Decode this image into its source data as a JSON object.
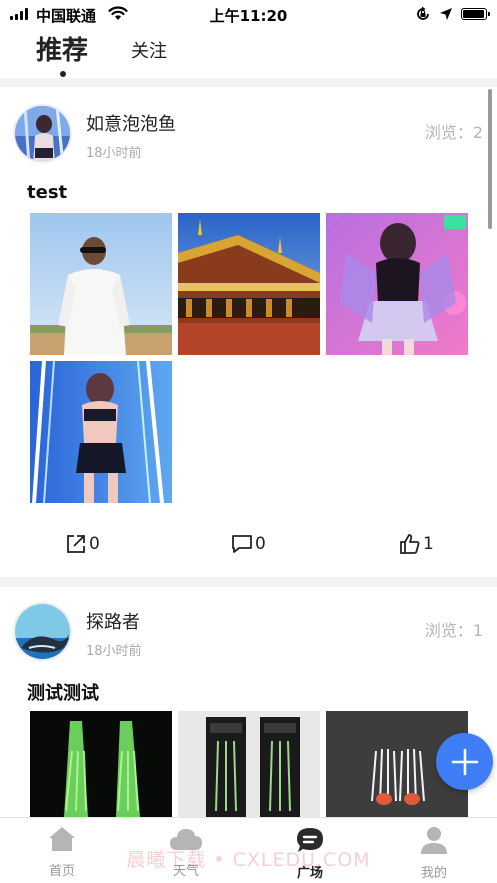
{
  "status_bar": {
    "carrier": "中国联通",
    "time": "上午11:20",
    "icons": [
      "signal-icon",
      "wifi-icon",
      "orientation-lock-icon",
      "location-icon",
      "battery-icon"
    ],
    "battery_level": 0.95
  },
  "header": {
    "tabs": [
      {
        "label": "推荐",
        "active": true
      },
      {
        "label": "关注",
        "active": false
      }
    ]
  },
  "posts": [
    {
      "username": "如意泡泡鱼",
      "time": "18小时前",
      "views": "浏览：2",
      "text": "test",
      "images": [
        "man-white-tshirt-sunglasses",
        "temple-building-blue-sky",
        "anime-girl-neon-pink",
        "anime-girl-neon-lights"
      ],
      "share_count": "0",
      "comment_count": "0",
      "like_count": "1"
    },
    {
      "username": "探路者",
      "time": "18小时前",
      "views": "浏览：1",
      "text": "测试测试",
      "images": [
        "glowing-fishing-lures",
        "packaged-fishing-lures",
        "white-feather-lure"
      ]
    }
  ],
  "fab": {
    "icon": "plus-icon"
  },
  "bottom_nav": {
    "items": [
      {
        "label": "首页",
        "icon": "home-icon",
        "active": false
      },
      {
        "label": "天气",
        "icon": "cloud-icon",
        "active": false
      },
      {
        "label": "广场",
        "icon": "chat-bubble-icon",
        "active": true
      },
      {
        "label": "我的",
        "icon": "person-icon",
        "active": false
      }
    ]
  },
  "watermark": "晨曦下载 • CXLEDU.COM",
  "colors": {
    "accent": "#3f7ef6",
    "muted": "#aaaaaa",
    "background": "#f2f2f2"
  }
}
